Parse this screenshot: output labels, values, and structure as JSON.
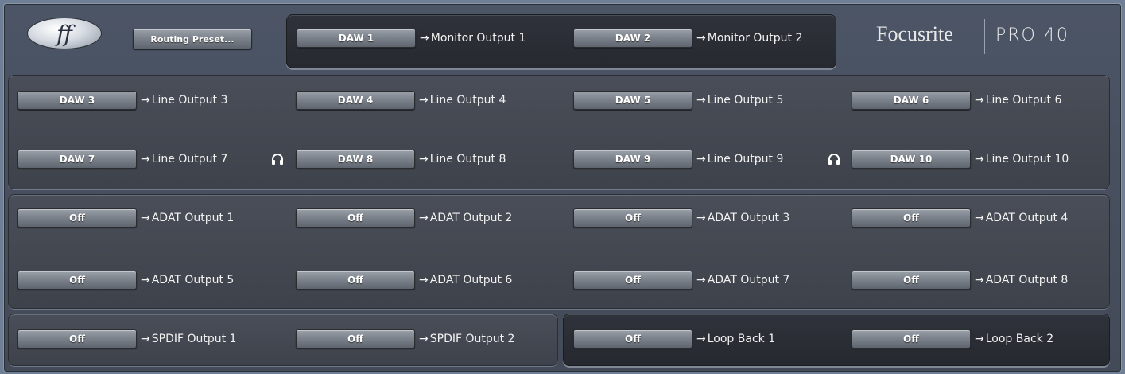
{
  "header": {
    "logo_glyph": "ff",
    "routing_preset_label": "Routing Preset...",
    "brand_name": "Focusrite",
    "brand_model": "PRO 40"
  },
  "monitor": [
    {
      "source": "DAW 1",
      "dest": "Monitor Output 1"
    },
    {
      "source": "DAW 2",
      "dest": "Monitor Output 2"
    }
  ],
  "line_outputs": [
    {
      "source": "DAW 3",
      "dest": "Line Output 3"
    },
    {
      "source": "DAW 4",
      "dest": "Line Output 4"
    },
    {
      "source": "DAW 5",
      "dest": "Line Output 5"
    },
    {
      "source": "DAW 6",
      "dest": "Line Output 6"
    },
    {
      "source": "DAW 7",
      "dest": "Line Output 7"
    },
    {
      "source": "DAW 8",
      "dest": "Line Output 8"
    },
    {
      "source": "DAW 9",
      "dest": "Line Output 9"
    },
    {
      "source": "DAW 10",
      "dest": "Line Output 10"
    }
  ],
  "adat_outputs": [
    {
      "source": "Off",
      "dest": "ADAT Output 1"
    },
    {
      "source": "Off",
      "dest": "ADAT Output 2"
    },
    {
      "source": "Off",
      "dest": "ADAT Output 3"
    },
    {
      "source": "Off",
      "dest": "ADAT Output 4"
    },
    {
      "source": "Off",
      "dest": "ADAT Output 5"
    },
    {
      "source": "Off",
      "dest": "ADAT Output 6"
    },
    {
      "source": "Off",
      "dest": "ADAT Output 7"
    },
    {
      "source": "Off",
      "dest": "ADAT Output 8"
    }
  ],
  "spdif_outputs": [
    {
      "source": "Off",
      "dest": "SPDIF Output 1"
    },
    {
      "source": "Off",
      "dest": "SPDIF Output 2"
    }
  ],
  "loopback": [
    {
      "source": "Off",
      "dest": "Loop Back 1"
    },
    {
      "source": "Off",
      "dest": "Loop Back 2"
    }
  ],
  "arrow_glyph": "→",
  "icons": {
    "headphones": "headphones-icon"
  }
}
